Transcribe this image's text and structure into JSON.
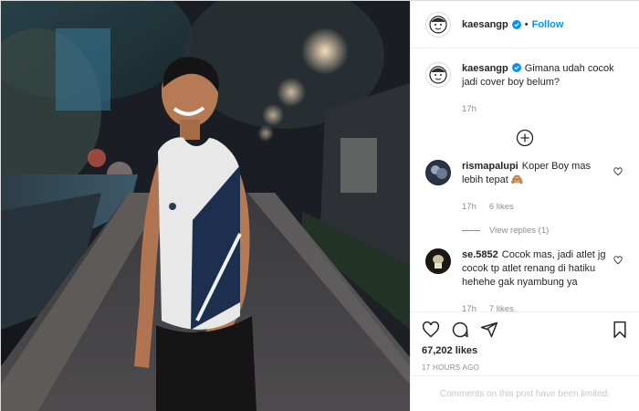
{
  "post": {
    "author": "kaesangp",
    "follow_label": "Follow",
    "separator": "•",
    "caption_user": "kaesangp",
    "caption_text": "Gimana udah cocok jadi cover boy belum?",
    "caption_time": "17h"
  },
  "comments": [
    {
      "user": "rismapalupi",
      "text": "Koper Boy mas lebih tepat 🙈",
      "time": "17h",
      "likes": "6 likes",
      "view_replies": "View replies (1)"
    },
    {
      "user": "se.5852",
      "text": "Cocok mas, jadi atlet jg cocok tp atlet renang di hatiku hehehe gak nyambung ya",
      "time": "17h",
      "likes": "7 likes"
    }
  ],
  "stats": {
    "likes": "67,202 likes",
    "posted_ago": "17 HOURS AGO"
  },
  "footer": {
    "limited_text": "Comments on this post have been limited."
  },
  "icons": {
    "verified": "verified-badge-icon",
    "load_more": "plus-circle-icon",
    "like": "heart-icon",
    "comment": "comment-icon",
    "share": "share-icon",
    "save": "bookmark-icon"
  },
  "colors": {
    "accent": "#0095f6",
    "muted": "#8e8e8e",
    "limited_text": "#c7c7c7"
  }
}
